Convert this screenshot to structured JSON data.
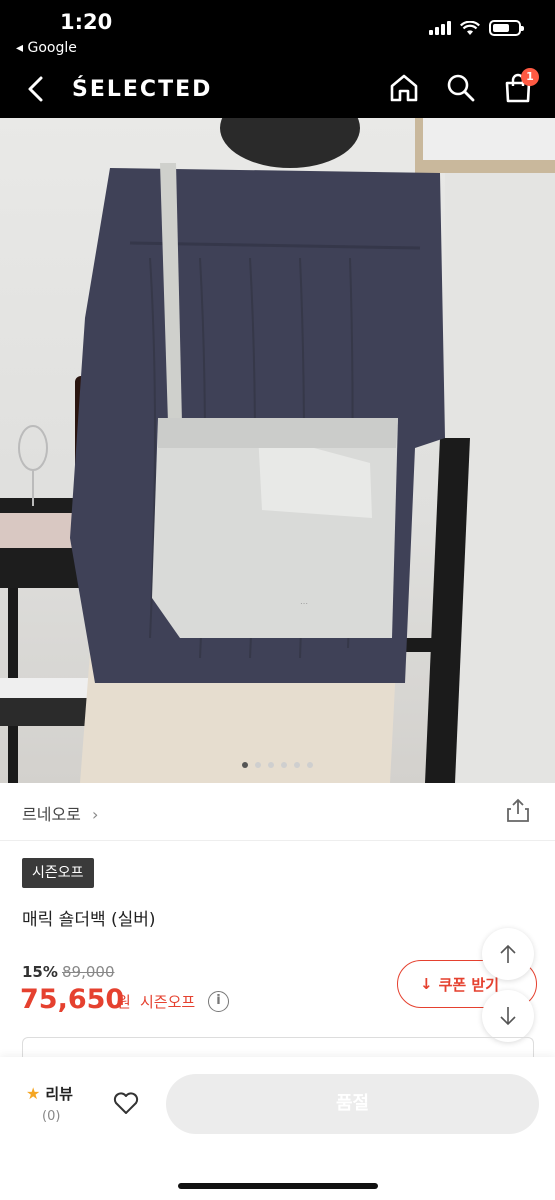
{
  "status_bar": {
    "time": "1:20",
    "back_app": "◂ Google"
  },
  "header": {
    "brand": "ŚELECTED",
    "cart_count": "1"
  },
  "gallery": {
    "dot_count": 6,
    "active_index": 0
  },
  "product": {
    "seller": "르네오로",
    "tag": "시즌오프",
    "title": "매릭 숄더백 (실버)",
    "discount": "15%",
    "original_price": "89,000",
    "price": "75,650",
    "currency": "원",
    "price_label": "시즌오프",
    "info_symbol": "i"
  },
  "coupon": {
    "label": "쿠폰 받기",
    "arrow": "↓"
  },
  "bottom": {
    "review_label": "리뷰",
    "review_count": "(0)",
    "soldout_label": "품절"
  },
  "colors": {
    "accent": "#e5412f",
    "badge": "#ff5a43",
    "header_bg": "#000000"
  }
}
